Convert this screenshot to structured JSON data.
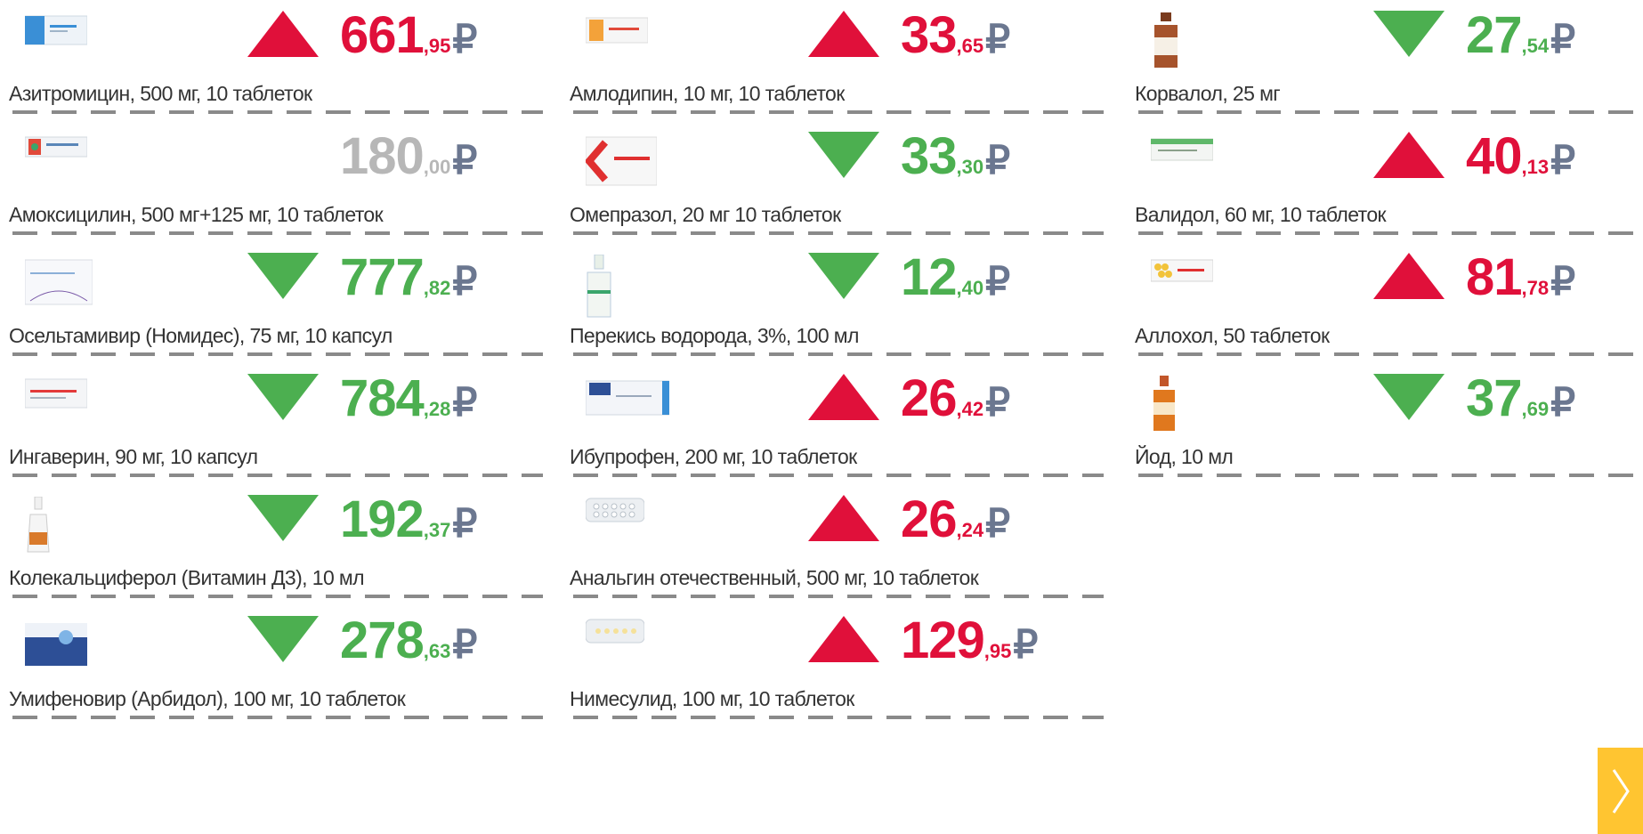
{
  "currency": "₽",
  "colors": {
    "up": "#e0103a",
    "down": "#4caf50",
    "flat": "#b7b7b7",
    "ruble": "#6b7790",
    "nav": "#ffc531"
  },
  "columns": [
    {
      "items": [
        {
          "name": "Азитромицин, 500 мг, 10 таблеток",
          "int": "661",
          "dec": ",95",
          "trend": "up",
          "icon": "blue-box"
        },
        {
          "name": "Амоксицилин, 500 мг+125 мг, 10 таблеток",
          "int": "180",
          "dec": ",00",
          "trend": "flat",
          "icon": "blister-box"
        },
        {
          "name": "Осельтамивир (Номидес), 75 мг, 10 капсул",
          "int": "777",
          "dec": ",82",
          "trend": "down",
          "icon": "white-box"
        },
        {
          "name": "Ингаверин, 90 мг, 10 капсул",
          "int": "784",
          "dec": ",28",
          "trend": "down",
          "icon": "red-stripe-box"
        },
        {
          "name": "Колекальциферол (Витамин Д3), 10 мл",
          "int": "192",
          "dec": ",37",
          "trend": "down",
          "icon": "dropper-bottle"
        },
        {
          "name": "Умифеновир (Арбидол), 100 мг, 10 таблеток",
          "int": "278",
          "dec": ",63",
          "trend": "down",
          "icon": "navy-box"
        }
      ]
    },
    {
      "items": [
        {
          "name": "Амлодипин, 10 мг, 10 таблеток",
          "int": "33",
          "dec": ",65",
          "trend": "up",
          "icon": "orange-box"
        },
        {
          "name": "Омепразол, 20 мг 10 таблеток",
          "int": "33",
          "dec": ",30",
          "trend": "down",
          "icon": "red-chevron-box"
        },
        {
          "name": "Перекись водорода, 3%, 100 мл",
          "int": "12",
          "dec": ",40",
          "trend": "down",
          "icon": "spray-bottle"
        },
        {
          "name": "Ибупрофен, 200 мг, 10 таблеток",
          "int": "26",
          "dec": ",42",
          "trend": "up",
          "icon": "blue-tablet-box"
        },
        {
          "name": "Анальгин отечественный, 500 мг, 10 таблеток",
          "int": "26",
          "dec": ",24",
          "trend": "up",
          "icon": "blister-pack"
        },
        {
          "name": "Нимесулид, 100 мг, 10 таблеток",
          "int": "129",
          "dec": ",95",
          "trend": "up",
          "icon": "yellow-blister"
        }
      ]
    },
    {
      "items": [
        {
          "name": "Корвалол, 25 мг",
          "int": "27",
          "dec": ",54",
          "trend": "down",
          "icon": "brown-bottle"
        },
        {
          "name": "Валидол, 60 мг, 10 таблеток",
          "int": "40",
          "dec": ",13",
          "trend": "up",
          "icon": "green-box"
        },
        {
          "name": "Аллохол, 50 таблеток",
          "int": "81",
          "dec": ",78",
          "trend": "up",
          "icon": "yellow-pills-box"
        },
        {
          "name": "Йод, 10 мл",
          "int": "37",
          "dec": ",69",
          "trend": "down",
          "icon": "iodine-bottle"
        }
      ]
    }
  ]
}
